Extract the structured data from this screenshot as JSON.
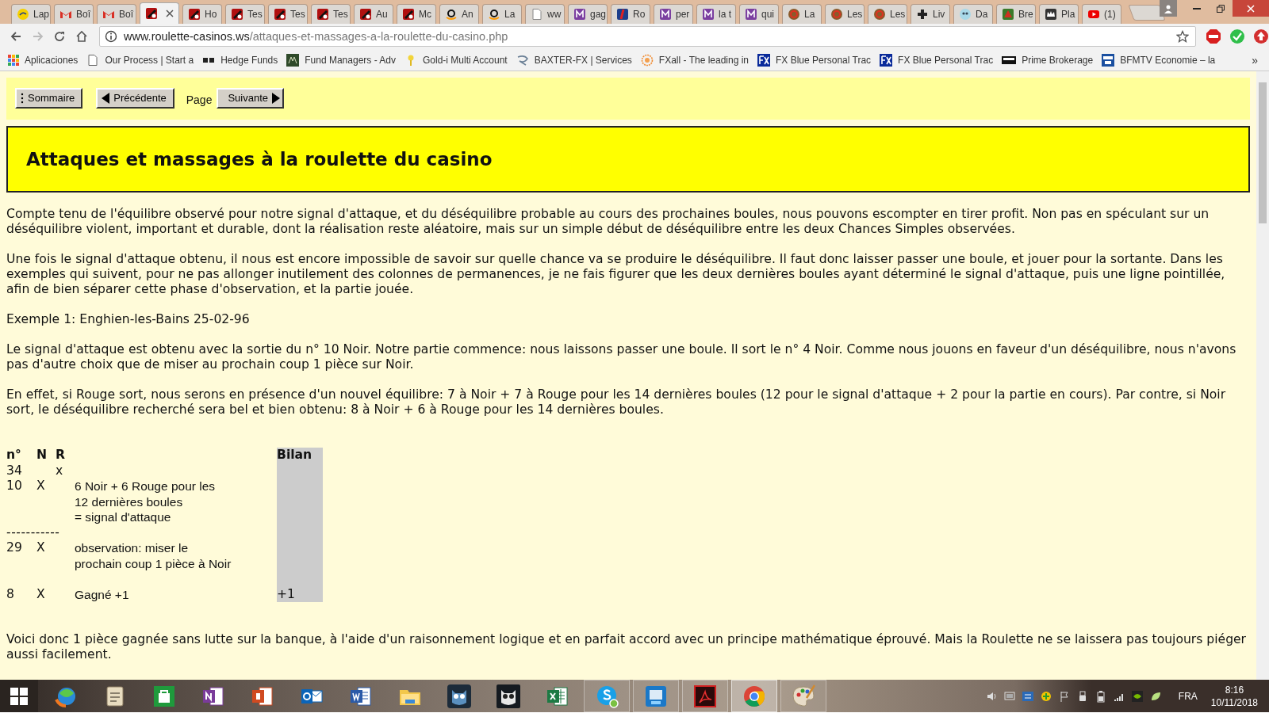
{
  "tabs": [
    {
      "kind": "post",
      "label": "Lap",
      "selected": false
    },
    {
      "kind": "gmail",
      "label": "Boî",
      "selected": false
    },
    {
      "kind": "gmail",
      "label": "Boî",
      "selected": false
    },
    {
      "kind": "roulette",
      "selected": true
    },
    {
      "kind": "roulette",
      "label": "Ho",
      "selected": false
    },
    {
      "kind": "roulette",
      "label": "Tes",
      "selected": false
    },
    {
      "kind": "roulette",
      "label": "Tes",
      "selected": false
    },
    {
      "kind": "roulette",
      "label": "Tes",
      "selected": false
    },
    {
      "kind": "roulette",
      "label": "Au",
      "selected": false
    },
    {
      "kind": "roulette",
      "label": "Mc",
      "selected": false
    },
    {
      "kind": "amazon",
      "label": "An",
      "selected": false
    },
    {
      "kind": "amazon",
      "label": "La",
      "selected": false
    },
    {
      "kind": "page",
      "label": "ww",
      "selected": false
    },
    {
      "kind": "m",
      "label": "gag",
      "selected": false
    },
    {
      "kind": "sj",
      "label": "Ro",
      "selected": false
    },
    {
      "kind": "m",
      "label": "per",
      "selected": false
    },
    {
      "kind": "m",
      "label": "la t",
      "selected": false
    },
    {
      "kind": "m",
      "label": "qui",
      "selected": false
    },
    {
      "kind": "j",
      "label": "La",
      "selected": false
    },
    {
      "kind": "j",
      "label": "Les",
      "selected": false
    },
    {
      "kind": "j",
      "label": "Les",
      "selected": false
    },
    {
      "kind": "plus",
      "label": "Liv",
      "selected": false
    },
    {
      "kind": "owl",
      "label": "Da",
      "selected": false
    },
    {
      "kind": "bird",
      "label": "Bre",
      "selected": false
    },
    {
      "kind": "crown",
      "label": "Pla",
      "selected": false
    },
    {
      "kind": "youtube",
      "label": "(1)",
      "selected": false
    }
  ],
  "address_bar": {
    "host": "www.roulette-casinos.ws",
    "path": "/attaques-et-massages-a-la-roulette-du-casino.php"
  },
  "bookmarks": [
    {
      "kind": "apps",
      "label": "Aplicaciones"
    },
    {
      "kind": "page",
      "label": "Our Process | Start a"
    },
    {
      "kind": "sh",
      "label": "Hedge Funds"
    },
    {
      "kind": "am",
      "label": "Fund Managers - Adv"
    },
    {
      "kind": "goldi",
      "label": "Gold-i Multi Account"
    },
    {
      "kind": "baxter",
      "label": "BAXTER-FX | Services"
    },
    {
      "kind": "fxall",
      "label": "FXall - The leading in"
    },
    {
      "kind": "fxblue",
      "label": "FX Blue Personal Trac"
    },
    {
      "kind": "fxblue",
      "label": "FX Blue Personal Trac"
    },
    {
      "kind": "saxo",
      "label": "Prime Brokerage"
    },
    {
      "kind": "bfm",
      "label": "BFMTV Economie – la"
    }
  ],
  "bookmarks_more": "»",
  "page_nav": [
    {
      "kind": "menu",
      "label": "Sommaire"
    },
    {
      "kind": "prev",
      "label": "Précédente"
    },
    {
      "kind": "text",
      "label": "Page"
    },
    {
      "kind": "next",
      "label": "Suivante"
    }
  ],
  "title": "Attaques et massages à la roulette du casino",
  "intro": [
    "Compte tenu de l'équilibre observé pour notre signal d'attaque, et du déséquilibre probable au cours des prochaines boules, nous pouvons escompter en tirer profit. Non pas en spéculant sur un déséquilibre violent, important et durable, dont la réalisation reste aléatoire, mais sur un simple début de déséquilibre entre les deux Chances Simples observées.",
    "Une fois le signal d'attaque obtenu, il nous est encore impossible de savoir sur quelle chance va se produire le déséquilibre. Il faut donc laisser passer une boule, et jouer pour la sortante. Dans les exemples qui suivent, pour ne pas allonger inutilement des colonnes de permanences, je ne fais figurer que les deux dernières boules ayant déterminé le signal d'attaque, puis une ligne pointillée, afin de bien séparer cette phase d'observation, et la partie jouée.",
    "Exemple 1: Enghien-les-Bains 25-02-96",
    "Le signal d'attaque est obtenu avec la sortie du n° 10 Noir. Notre partie commence: nous laissons passer une boule. Il sort le n° 4 Noir. Comme nous jouons en faveur d'un déséquilibre, nous n'avons pas d'autre choix que de miser au prochain coup 1 pièce sur Noir.",
    "En effet, si Rouge sort, nous serons en présence d'un nouvel équilibre: 7 à Noir + 7 à Rouge pour les 14 dernières boules (12 pour le signal d'attaque + 2 pour la partie en cours). Par contre, si Noir sort, le déséquilibre recherché sera bel et bien obtenu: 8 à Noir + 6 à Rouge pour les 14 dernières boules."
  ],
  "table": {
    "headers": {
      "number": "n°",
      "noir": "N",
      "rouge": "R",
      "bilan": "Bilan"
    },
    "rows": [
      {
        "kind": "spin",
        "number": "34",
        "rouge": "x"
      },
      {
        "kind": "spin",
        "number": "10",
        "noir": "X",
        "note": [
          "6 Noir + 6 Rouge pour les",
          "12 dernières boules",
          "= signal d'attaque"
        ]
      },
      {
        "kind": "separator",
        "text": "-----------"
      },
      {
        "kind": "spin",
        "number": "29",
        "noir": "X",
        "note": [
          "observation: miser le",
          "prochain coup 1 pièce à Noir"
        ]
      },
      {
        "kind": "blank"
      },
      {
        "kind": "spin",
        "number": "8",
        "noir": "X",
        "note": [
          "Gagné +1"
        ],
        "bilan": "+1"
      }
    ]
  },
  "outro": [
    "Voici donc 1 pièce gagnée sans lutte sur la banque, à l'aide d'un raisonnement logique et en parfait accord avec un principe mathématique éprouvé. Mais la Roulette ne se laissera pas toujours piéger aussi facilement."
  ],
  "taskbar": {
    "apps": [
      {
        "kind": "globe",
        "running": false,
        "selected": false
      },
      {
        "kind": "notes",
        "running": false,
        "selected": false
      },
      {
        "kind": "store",
        "running": false,
        "selected": false
      },
      {
        "kind": "onenote",
        "running": false,
        "selected": false
      },
      {
        "kind": "powerpoint",
        "running": false,
        "selected": false
      },
      {
        "kind": "outlook",
        "running": false,
        "selected": false
      },
      {
        "kind": "word",
        "running": false,
        "selected": false
      },
      {
        "kind": "folder",
        "running": false,
        "selected": false
      },
      {
        "kind": "owl",
        "running": false,
        "selected": false
      },
      {
        "kind": "owldark",
        "running": false,
        "selected": false
      },
      {
        "kind": "excel",
        "running": false,
        "selected": false
      },
      {
        "kind": "skype",
        "running": true,
        "selected": false
      },
      {
        "kind": "intel",
        "running": true,
        "selected": false
      },
      {
        "kind": "acrobat",
        "running": true,
        "selected": false
      },
      {
        "kind": "chrome",
        "running": true,
        "selected": true
      },
      {
        "kind": "paint",
        "running": true,
        "selected": false
      }
    ],
    "language": "FRA",
    "time": "8:16",
    "date": "10/11/2018"
  }
}
